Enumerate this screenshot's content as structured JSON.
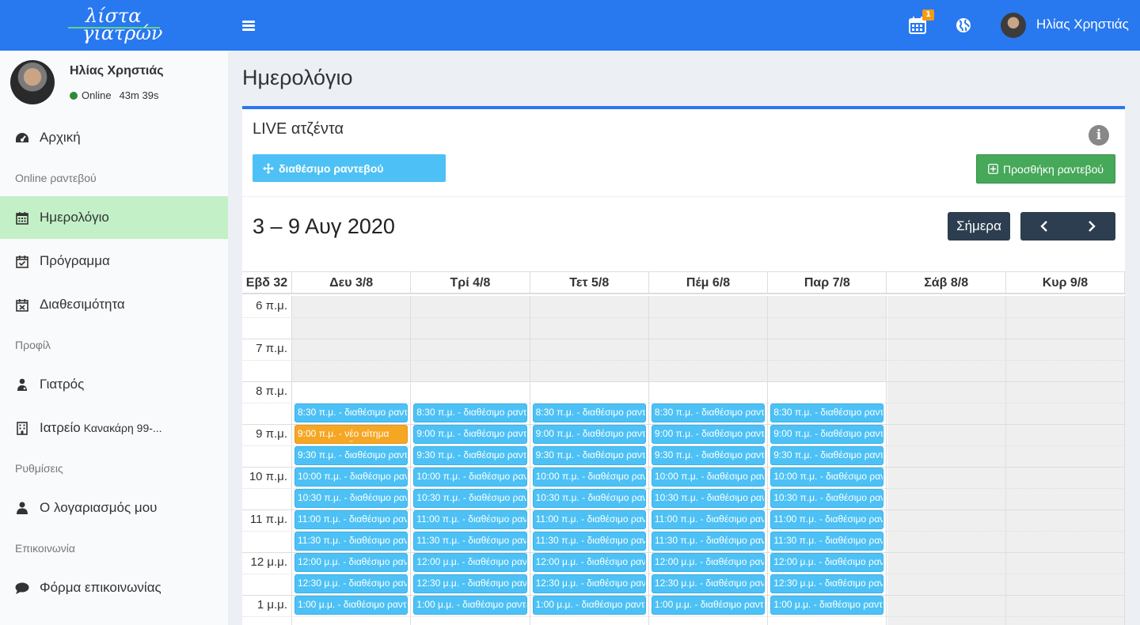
{
  "header": {
    "logo_line1": "λίστα",
    "logo_line2": "γιατρών",
    "notification_count": "1",
    "user_name": "Ηλίας Χρηστιάς"
  },
  "sidebar": {
    "user_name": "Ηλίας Χρηστιάς",
    "status": "Online",
    "session_time": "43m 39s",
    "items": [
      {
        "type": "item",
        "label": "Αρχική",
        "icon": "dashboard-icon"
      },
      {
        "type": "header",
        "label": "Online ραντεβού"
      },
      {
        "type": "item",
        "label": "Ημερολόγιο",
        "icon": "calendar-icon",
        "active": true
      },
      {
        "type": "item",
        "label": "Πρόγραμμα",
        "icon": "calendar-check-icon"
      },
      {
        "type": "item",
        "label": "Διαθεσιμότητα",
        "icon": "calendar-x-icon"
      },
      {
        "type": "header",
        "label": "Προφίλ"
      },
      {
        "type": "item",
        "label": "Γιατρός",
        "icon": "doctor-icon"
      },
      {
        "type": "item",
        "label": "Ιατρείο",
        "sublabel": "Κανακάρη 99-...",
        "icon": "building-icon"
      },
      {
        "type": "header",
        "label": "Ρυθμίσεις"
      },
      {
        "type": "item",
        "label": "Ο λογαριασμός μου",
        "icon": "user-icon"
      },
      {
        "type": "header",
        "label": "Επικοινωνία"
      },
      {
        "type": "item",
        "label": "Φόρμα επικοινωνίας",
        "icon": "comment-icon"
      }
    ]
  },
  "page": {
    "title": "Ημερολόγιο",
    "box_title": "LIVE ατζέντα",
    "available_button": "διαθέσιμο ραντεβού",
    "add_button": "Προσθήκη ραντεβού",
    "range_title": "3 – 9 Αυγ 2020",
    "today_button": "Σήμερα"
  },
  "calendar": {
    "week_label": "Εβδ 32",
    "days": [
      "Δευ 3/8",
      "Τρί 4/8",
      "Τετ 5/8",
      "Πέμ 6/8",
      "Παρ 7/8",
      "Σάβ 8/8",
      "Κυρ 9/8"
    ],
    "hours": [
      "6 π.μ.",
      "7 π.μ.",
      "8 π.μ.",
      "9 π.μ.",
      "10 π.μ.",
      "11 π.μ.",
      "12 μ.μ.",
      "1 μ.μ."
    ],
    "slot_times": [
      "8:30 π.μ.",
      "9:00 π.μ.",
      "9:30 π.μ.",
      "10:00 π.μ.",
      "10:30 π.μ.",
      "11:00 π.μ.",
      "11:30 π.μ.",
      "12:00 μ.μ.",
      "12:30 μ.μ.",
      "1:00 μ.μ."
    ],
    "event_label": "διαθέσιμο ραντεβού",
    "request_label": "νέο αίτημα",
    "request_day": 0,
    "request_slot": 1,
    "event_days": 5,
    "colors": {
      "available": "#4dc1f5",
      "request": "#f5a623",
      "active_menu": "#c3f0c7",
      "header": "#2878f0"
    }
  }
}
